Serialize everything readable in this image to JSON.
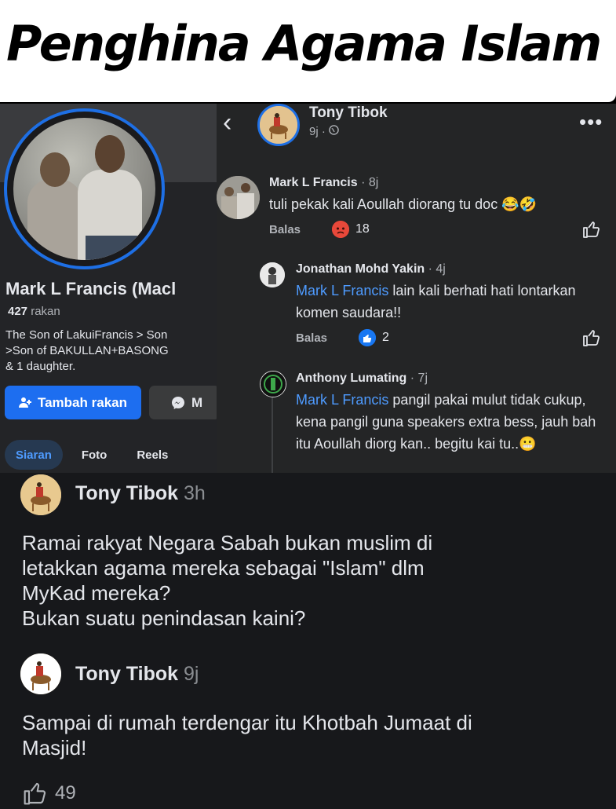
{
  "banner": {
    "title": "Penghina Agama Islam"
  },
  "profile": {
    "name": "Mark L Francis (Macl",
    "friends_count": "427",
    "friends_label": "rakan",
    "bio": "The Son of LakuiFrancis > Son\n>Son of BAKULLAN+BASONG \n& 1 daughter.",
    "add_friend_label": "Tambah rakan",
    "message_label": "M",
    "tabs": [
      "Siaran",
      "Foto",
      "Reels"
    ],
    "accent_color": "#1d6ef0"
  },
  "comments_panel": {
    "post_author": "Tony Tibok",
    "post_time": "9j ·",
    "comments": [
      {
        "author": "Mark L Francis",
        "time": "· 8j",
        "text": "tuli pekak kali Aoullah diorang tu doc 😂🤣",
        "reply_label": "Balas",
        "reaction_count": "18"
      },
      {
        "author": "Jonathan Mohd Yakin",
        "time": "· 4j",
        "mention": "Mark L Francis",
        "text": " lain kali berhati hati lontarkan komen saudara!!",
        "reply_label": "Balas",
        "reaction_count": "2"
      },
      {
        "author": "Anthony Lumating",
        "time": "· 7j",
        "mention": "Mark L Francis",
        "text": " pangil pakai mulut tidak cukup, kena pangil guna speakers extra bess, jauh bah itu Aoullah diorg kan.. begitu kai tu..😬"
      }
    ]
  },
  "bottom_posts": [
    {
      "author": "Tony Tibok",
      "time": "3h",
      "text": "Ramai rakyat Negara Sabah bukan muslim di\nletakkan agama mereka sebagai \"Islam\" dlm\nMyKad mereka?\nBukan suatu penindasan kaini?"
    },
    {
      "author": "Tony Tibok",
      "time": "9j",
      "text": "Sampai di rumah terdengar itu Khotbah Jumaat di\nMasjid!"
    }
  ],
  "likes_count": "49",
  "icons": [
    "back-arrow-icon",
    "globe-icon",
    "more-icon",
    "add-friend-icon",
    "messenger-icon",
    "angry-reaction-icon",
    "like-reaction-icon",
    "thumbs-up-icon"
  ]
}
